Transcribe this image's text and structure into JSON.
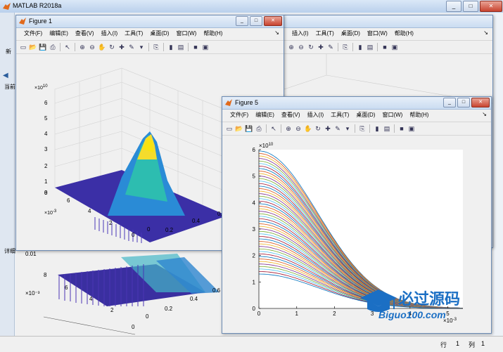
{
  "app": {
    "title": "MATLAB R2018a"
  },
  "window_controls": {
    "minimize": "_",
    "maximize": "□",
    "close": "✕"
  },
  "main_bg": {
    "left_labels": [
      "新",
      "当前",
      "详细"
    ],
    "background_plot": {
      "y_tick_top": "0.01",
      "y_ticks": [
        "8",
        "6",
        "4",
        "2",
        "0"
      ],
      "x_ticks": [
        "0",
        "0.2",
        "0.4",
        "0.6"
      ],
      "y_exponent": "×10⁻³"
    }
  },
  "figure1": {
    "title": "Figure 1",
    "menu": [
      "文件(F)",
      "编辑(E)",
      "查看(V)",
      "插入(I)",
      "工具(T)",
      "桌面(D)",
      "窗口(W)",
      "帮助(H)"
    ],
    "plot": {
      "z_exponent": "×10",
      "z_exponent_power": "10",
      "z_ticks": [
        "6",
        "5",
        "4",
        "3",
        "2",
        "1",
        "0"
      ],
      "y_ticks": [
        "8",
        "6",
        "4",
        "2",
        "0"
      ],
      "y_exponent": "×10",
      "y_exponent_power": "-3",
      "x_ticks": [
        "0",
        "0.2",
        "0.4",
        "0.6"
      ]
    }
  },
  "figure_behind": {
    "menu": [
      "插入(I)",
      "工具(T)",
      "桌面(D)",
      "窗口(W)",
      "帮助(H)"
    ]
  },
  "figure5": {
    "title": "Figure 5",
    "menu": [
      "文件(F)",
      "编辑(E)",
      "查看(V)",
      "插入(I)",
      "工具(T)",
      "桌面(D)",
      "窗口(W)",
      "帮助(H)"
    ]
  },
  "chart_data": {
    "type": "line",
    "title": "",
    "xlabel": "",
    "ylabel": "",
    "x_exponent_label": "×10",
    "x_exponent_power": "-3",
    "y_exponent_label": "×10",
    "y_exponent_power": "10",
    "xlim": [
      0,
      5.4
    ],
    "ylim": [
      0,
      6
    ],
    "x_ticks": [
      "0",
      "1",
      "2",
      "3",
      "4",
      "5"
    ],
    "y_ticks": [
      "0",
      "1",
      "2",
      "3",
      "4",
      "5",
      "6"
    ],
    "curve_family": {
      "description_count": 50,
      "peak_y_min": 1.3,
      "peak_y_max": 5.95,
      "decay_width": 2.2,
      "colors": [
        "#0072bd",
        "#d95319",
        "#edb120",
        "#7e2f8e",
        "#77ac30",
        "#4dbeee",
        "#a2142f"
      ]
    },
    "grid": false
  },
  "status": {
    "row_label": "行",
    "row_value": "1",
    "col_label": "列",
    "col_value": "1"
  },
  "watermark": {
    "cn": "必过源码",
    "en": "Biguo100.com"
  }
}
